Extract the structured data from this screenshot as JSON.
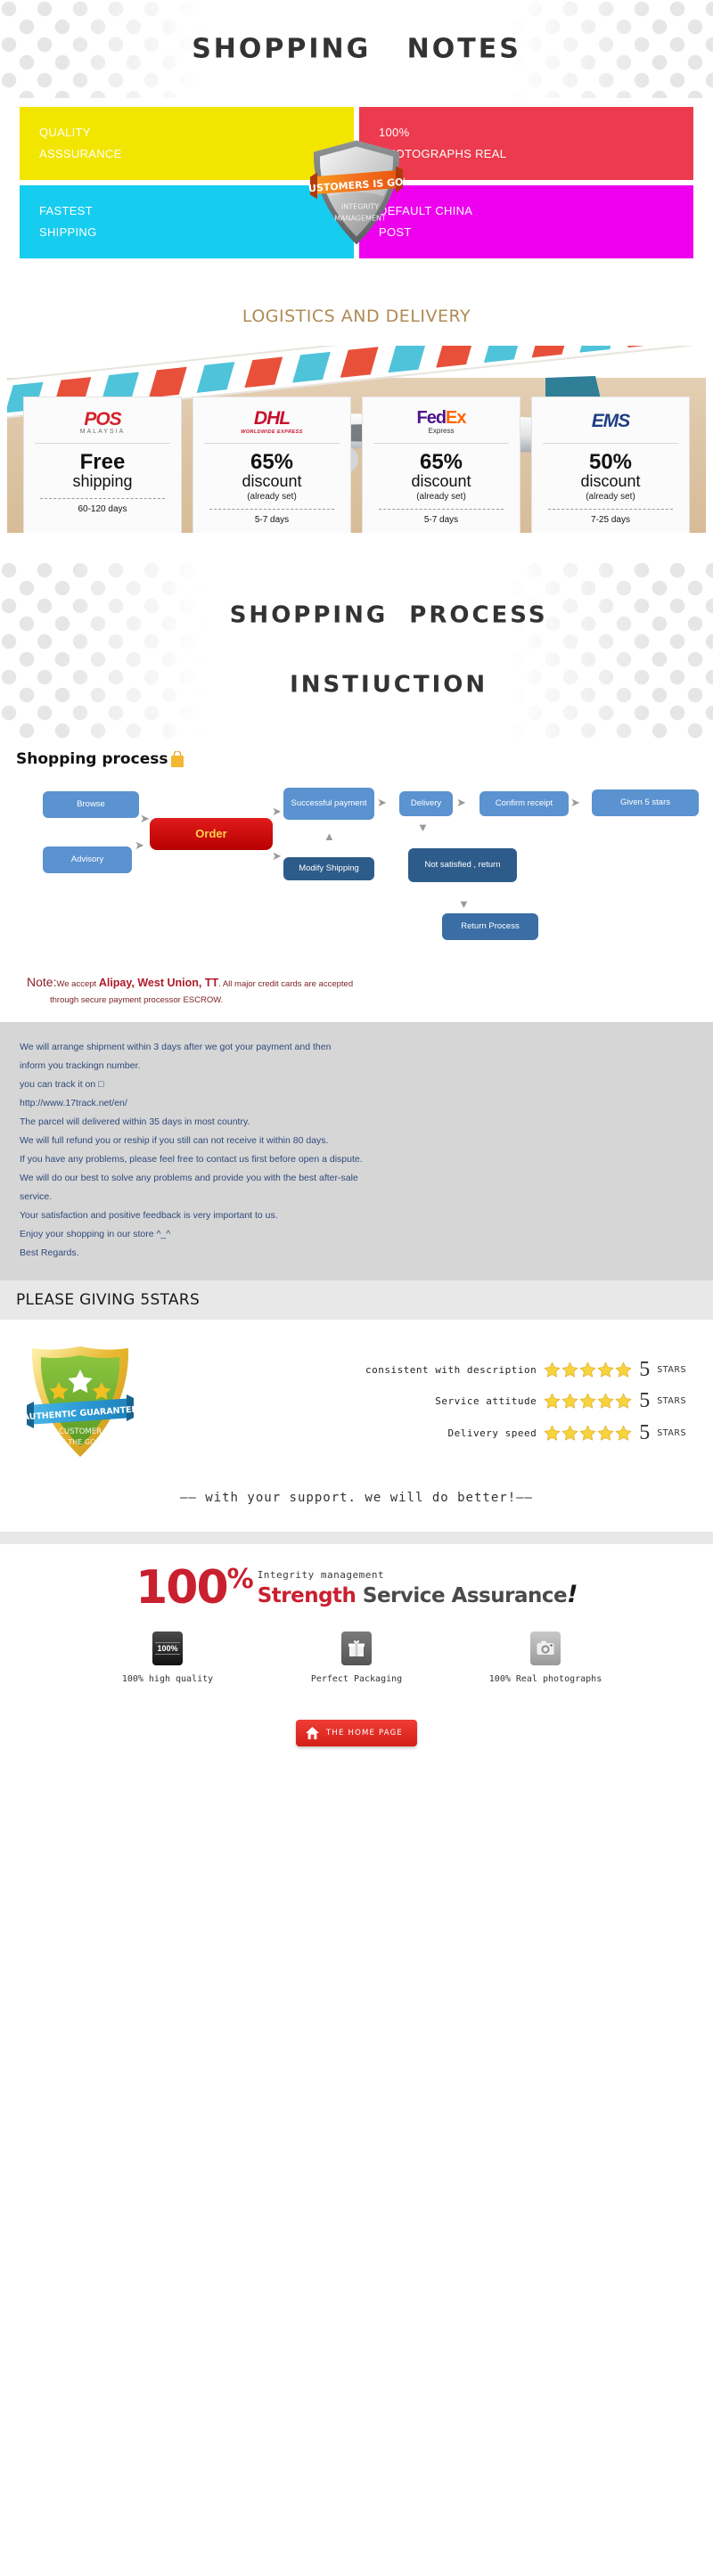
{
  "header": {
    "title": "SHOPPING   NOTES"
  },
  "quadrants": [
    {
      "line1": "QUALITY",
      "line2": "ASSSURANCE",
      "color": "#f2e500"
    },
    {
      "line1": "100%",
      "line2": "PHOTOGRAPHS REAL",
      "color": "#ec3b4e"
    },
    {
      "line1": "FASTEST",
      "line2": "SHIPPING",
      "color": "#16ccef"
    },
    {
      "line1": "DEFAULT CHINA",
      "line2": "POST",
      "color": "#ee00ee"
    }
  ],
  "shield_badge": {
    "ribbon": "CUSTOMERS IS GOD",
    "line1": "INTEGRITY",
    "line2": "MANAGEMENT"
  },
  "logistics": {
    "title": "LOGISTICS AND DELIVERY",
    "carriers": [
      {
        "logo_name": "pos-malaysia-logo",
        "logo_text": "POS",
        "logo_sub": "MALAYSIA",
        "main": "Free",
        "sub": "shipping",
        "note": "",
        "days": "60-120 days"
      },
      {
        "logo_name": "dhl-logo",
        "logo_text": "DHL",
        "logo_sub": "WORLDWIDE EXPRESS",
        "main": "65%",
        "sub": "discount",
        "note": "(already set)",
        "days": "5-7 days"
      },
      {
        "logo_name": "fedex-logo",
        "logo_text": "FedEx",
        "logo_sub": "Express",
        "main": "65%",
        "sub": "discount",
        "note": "(already set)",
        "days": "5-7 days"
      },
      {
        "logo_name": "ems-logo",
        "logo_text": "EMS",
        "logo_sub": "",
        "main": "50%",
        "sub": "discount",
        "note": "(already set)",
        "days": "7-25 days"
      }
    ]
  },
  "process_header": {
    "line1": "SHOPPING  PROCESS",
    "line2": "INSTIUCTION"
  },
  "flowchart": {
    "title": "Shopping process",
    "nodes": {
      "browse": "Browse",
      "advisory": "Advisory",
      "order": "Order",
      "successful_payment": "Successful payment",
      "modify_shipping": "Modify Shipping",
      "delivery": "Delivery",
      "not_satisfied": "Not satisfied , return",
      "confirm_receipt": "Confirm receipt",
      "given_5_stars": "Given 5 stars",
      "return_process": "Return Process"
    }
  },
  "note": {
    "label": "Note:",
    "text_before": "We accept ",
    "payments": "Alipay, West Union, TT",
    "text_after": ". All major credit cards are accepted",
    "line2": "through secure payment processor ESCROW."
  },
  "policy": {
    "lines": [
      "We will arrange shipment within 3 days after we got your payment and then",
      "inform you trackingn number.",
      "you can track it on □",
      "http://www.17track.net/en/",
      "The parcel will delivered within 35 days in most country.",
      "We will full refund you or reship if you still can not receive it within 80 days.",
      "If you have any problems, please feel free to contact us first before open a dispute.",
      "We will do our best to solve any problems and provide you with the best after-sale",
      "service.",
      "Your satisfaction and positive feedback is very important to us.",
      "Enjoy your shopping in our store ^_^",
      "Best Regards."
    ]
  },
  "stars_section": {
    "heading": "PLEASE GIVING 5STARS",
    "badge": {
      "ribbon": "AUTHENTIC GUARANTEE",
      "line1": "CUSTOMER",
      "line2": "IS THE GOD"
    },
    "ratings": [
      {
        "label": "consistent with description",
        "stars": 5,
        "value": "5",
        "unit": "STARS"
      },
      {
        "label": "Service attitude",
        "stars": 5,
        "value": "5",
        "unit": "STARS"
      },
      {
        "label": "Delivery speed",
        "stars": 5,
        "value": "5",
        "unit": "STARS"
      }
    ],
    "slogan": "—— with your support. we will do better!——"
  },
  "footer": {
    "hundred": "100",
    "percent": "%",
    "integrity": "Integrity management",
    "strength_red": "Strength",
    "strength_grey": "Service Assurance",
    "bang": "!",
    "features": [
      {
        "icon": "quality-badge-icon",
        "badge_text": "100%",
        "label": "100% high quality"
      },
      {
        "icon": "gift-box-icon",
        "badge_text": "",
        "label": "Perfect Packaging"
      },
      {
        "icon": "camera-icon",
        "badge_text": "",
        "label": "100% Real photographs"
      }
    ],
    "home_button": "THE HOME PAGE"
  },
  "colors": {
    "yellow": "#f2e500",
    "red": "#ec3b4e",
    "cyan": "#16ccef",
    "magenta": "#ee00ee",
    "brown_title": "#b08a55",
    "policy_text": "#2f4a7a",
    "flow_blue": "#5b92d0",
    "flow_dark_blue": "#2e5c8a",
    "order_red": "#c41010",
    "brand_red": "#c9202f"
  }
}
